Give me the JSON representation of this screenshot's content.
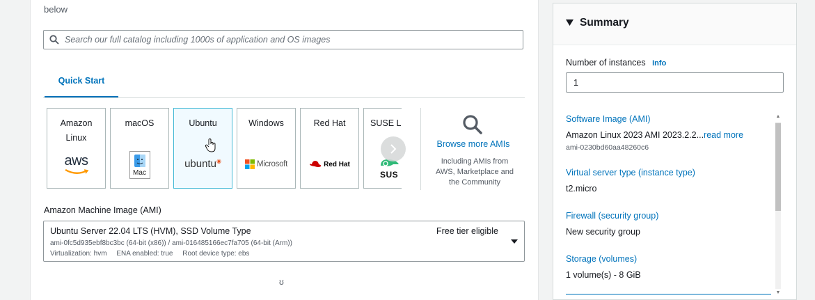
{
  "launch": {
    "intro_fragment": "below",
    "search_placeholder": "Search our full catalog including 1000s of application and OS images",
    "tab_quick_start": "Quick Start",
    "os_cards": [
      {
        "name": "Amazon Linux",
        "logo_text": "aws"
      },
      {
        "name": "macOS",
        "logo_text": "Mac"
      },
      {
        "name": "Ubuntu",
        "logo_text": "ubuntu",
        "selected": true
      },
      {
        "name": "Windows",
        "logo_text": "Microsoft"
      },
      {
        "name": "Red Hat",
        "logo_text": "Red Hat"
      },
      {
        "name": "SUSE Li",
        "logo_text": "SUS"
      }
    ],
    "browse_more_label": "Browse more AMIs",
    "browse_more_sub": "Including AMIs from AWS, Marketplace and the Community",
    "ami_label": "Amazon Machine Image (AMI)",
    "ami_selected": {
      "name": "Ubuntu Server 22.04 LTS (HVM), SSD Volume Type",
      "ids": "ami-0fc5d935ebf8bc3bc (64-bit (x86)) / ami-016485166ec7fa705 (64-bit (Arm))",
      "virtualization": "Virtualization: hvm",
      "ena": "ENA enabled: true",
      "root_device": "Root device type: ebs",
      "badge": "Free tier eligible"
    },
    "spinner_glyph": "ʊ"
  },
  "summary": {
    "title": "Summary",
    "instances_label": "Number of instances",
    "info_label": "Info",
    "instances_value": "1",
    "software_image_link": "Software Image (AMI)",
    "software_image_value": "Amazon Linux 2023 AMI 2023.2.2...",
    "read_more": "read more",
    "software_image_id": "ami-0230bd60aa48260c6",
    "instance_type_link": "Virtual server type (instance type)",
    "instance_type_value": "t2.micro",
    "firewall_link": "Firewall (security group)",
    "firewall_value": "New security group",
    "storage_link": "Storage (volumes)",
    "storage_value": "1 volume(s) - 8 GiB"
  },
  "colors": {
    "link": "#0073bb",
    "selected_card_bg": "#f1faff",
    "selected_card_border": "#44b9d6",
    "page_bg": "#f2f3f3"
  }
}
